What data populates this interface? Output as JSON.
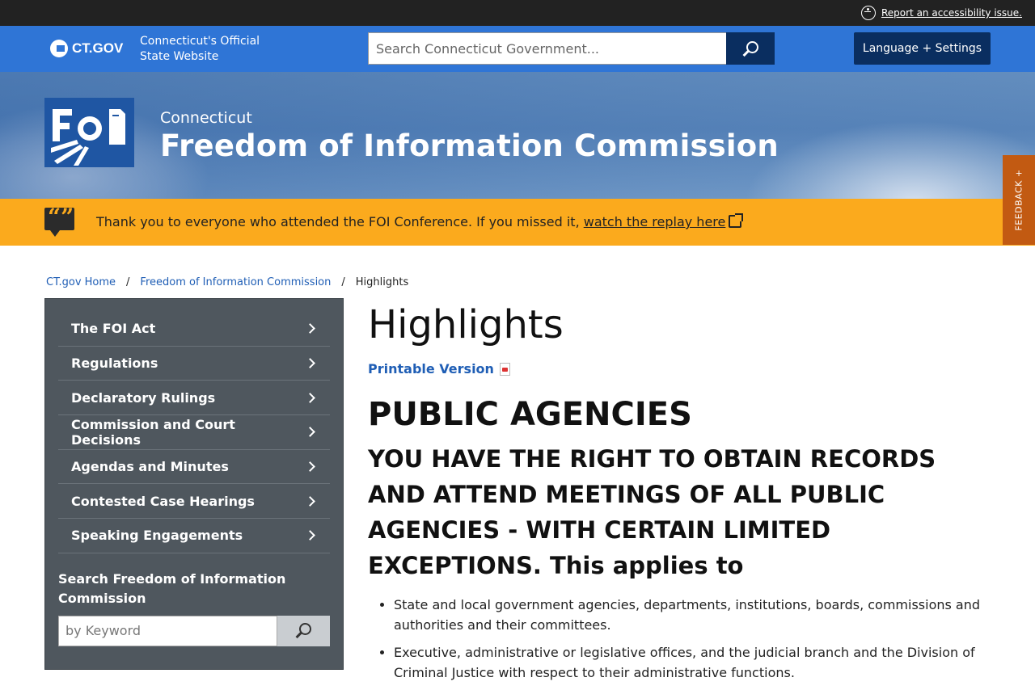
{
  "a11y": {
    "link_text": "Report an accessibility issue."
  },
  "header": {
    "logo_text": "CT.GOV",
    "tagline": "Connecticut's Official State Website",
    "search_placeholder": "Search Connecticut Government...",
    "language_button": "Language + Settings"
  },
  "banner": {
    "subtitle": "Connecticut",
    "title": "Freedom of Information Commission",
    "logo_text": "FOI"
  },
  "feedback": {
    "label": "FEEDBACK +"
  },
  "alert": {
    "text": "Thank you to everyone who attended the FOI Conference. If you missed it, ",
    "link": "watch the replay here"
  },
  "breadcrumb": {
    "items": [
      "CT.gov Home",
      "Freedom of Information Commission"
    ],
    "current": "Highlights",
    "separator": "/"
  },
  "sidebar": {
    "items": [
      "The FOI Act",
      "Regulations",
      "Declaratory Rulings",
      "Commission and Court Decisions",
      "Agendas and Minutes",
      "Contested Case Hearings",
      "Speaking Engagements"
    ],
    "search_label": "Search Freedom of Information Commission",
    "search_placeholder": "by Keyword"
  },
  "main": {
    "title": "Highlights",
    "printable": "Printable Version",
    "h2": "PUBLIC AGENCIES",
    "h3": "YOU HAVE THE RIGHT TO OBTAIN RECORDS AND ATTEND MEETINGS OF ALL PUBLIC AGENCIES - WITH CERTAIN LIMITED EXCEPTIONS. This applies to",
    "bullets": [
      "State and local government agencies, departments, institutions, boards, commissions and authorities and their committees.",
      "Executive, administrative or legislative offices, and the judicial branch and the Division of Criminal Justice with respect to their administrative functions."
    ]
  },
  "colors": {
    "header_blue": "#2f75d6",
    "navy": "#0a2e60",
    "alert_orange": "#fbaa1d",
    "feedback_orange": "#c25a12",
    "sidebar_gray": "#4f575e",
    "link_blue": "#1f5eb5"
  }
}
